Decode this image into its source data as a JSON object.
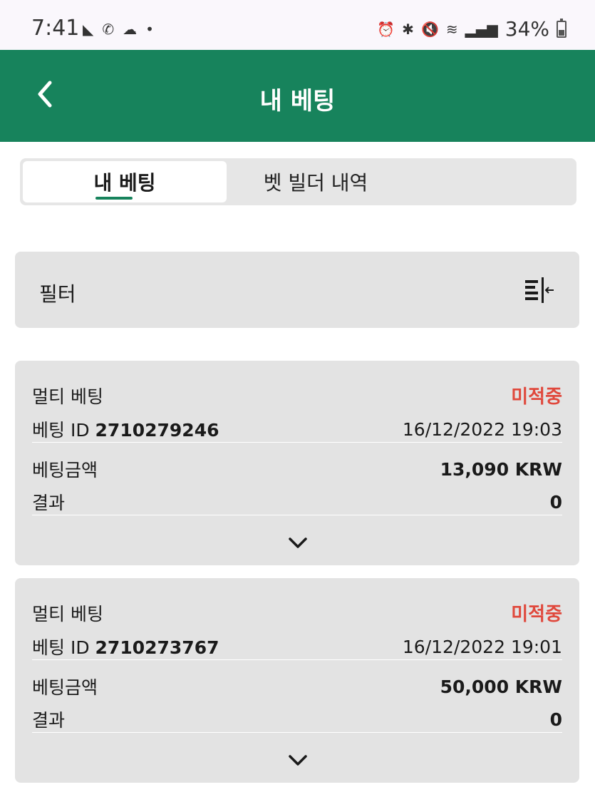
{
  "status_bar": {
    "time": "7:41",
    "left_icons": [
      "ear-icon",
      "missed-call-icon",
      "cloud-icon",
      "dot-icon"
    ],
    "right_icons": [
      "alarm-icon",
      "bluetooth-icon",
      "mute-icon",
      "wifi-icon",
      "signal-icon"
    ],
    "battery": "34%"
  },
  "app_bar": {
    "title": "내 베팅"
  },
  "tabs": [
    {
      "label": "내 베팅",
      "active": true
    },
    {
      "label": "벳 빌더 내역",
      "active": false
    }
  ],
  "filter": {
    "label": "필터"
  },
  "bets": [
    {
      "type": "멀티 베팅",
      "status": "미적중",
      "id_label": "베팅 ID",
      "id": "2710279246",
      "datetime": "16/12/2022 19:03",
      "amount_label": "베팅금액",
      "amount": "13,090 KRW",
      "result_label": "결과",
      "result": "0"
    },
    {
      "type": "멀티 베팅",
      "status": "미적중",
      "id_label": "베팅 ID",
      "id": "2710273767",
      "datetime": "16/12/2022 19:01",
      "amount_label": "베팅금액",
      "amount": "50,000 KRW",
      "result_label": "결과",
      "result": "0"
    }
  ],
  "colors": {
    "primary": "#17835c",
    "loss": "#e0483c"
  }
}
